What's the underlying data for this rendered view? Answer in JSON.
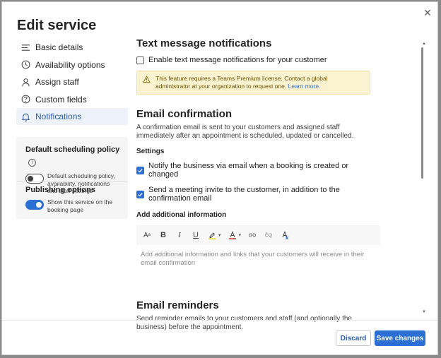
{
  "dialog": {
    "title": "Edit service"
  },
  "nav": {
    "items": [
      {
        "label": "Basic details",
        "icon": "list-icon"
      },
      {
        "label": "Availability options",
        "icon": "clock-icon"
      },
      {
        "label": "Assign staff",
        "icon": "person-icon"
      },
      {
        "label": "Custom fields",
        "icon": "question-icon"
      },
      {
        "label": "Notifications",
        "icon": "bell-icon",
        "active": true
      }
    ]
  },
  "panel": {
    "scheduling": {
      "title": "Default scheduling policy",
      "toggle_text": "Default scheduling policy, availability, notifications and staff settings",
      "toggle_on": false
    },
    "publishing": {
      "title": "Publishing options",
      "toggle_text": "Show this service on the booking page",
      "toggle_on": true
    }
  },
  "sms": {
    "heading": "Text message notifications",
    "checkbox_label": "Enable text message notifications for your customer",
    "checked": false,
    "warning_text": "This feature requires a Teams Premium license. Contact a global administrator at your organization to request one.",
    "warning_link": "Learn more."
  },
  "email_confirmation": {
    "heading": "Email confirmation",
    "description": "A confirmation email is sent to your customers and assigned staff immediately after an appointment is scheduled, updated or cancelled.",
    "settings_label": "Settings",
    "options": [
      {
        "label": "Notify the business via email when a booking is created or changed",
        "checked": true
      },
      {
        "label": "Send a meeting invite to the customer, in addition to the confirmation email",
        "checked": true
      }
    ],
    "additional_label": "Add additional information",
    "editor_placeholder": "Add additional information and links that your customers will receive in their email confirmation"
  },
  "email_reminders": {
    "heading": "Email reminders",
    "description": "Send reminder emails to your customers and staff (and optionally the business) before the appointment."
  },
  "footer": {
    "discard_label": "Discard",
    "save_label": "Save changes"
  },
  "colors": {
    "accent": "#2b6fd4",
    "warning_bg": "#fbf3d0"
  }
}
